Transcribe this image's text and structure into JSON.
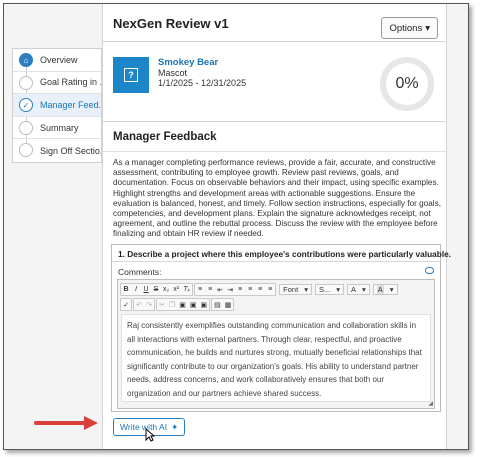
{
  "header": {
    "title": "NexGen Review v1",
    "options_label": "Options"
  },
  "steps": [
    {
      "label": "Overview",
      "state": "home"
    },
    {
      "label": "Goal Rating in ...",
      "state": "pending"
    },
    {
      "label": "Manager Feed...",
      "state": "active"
    },
    {
      "label": "Summary",
      "state": "pending"
    },
    {
      "label": "Sign Off Sectio...",
      "state": "pending"
    }
  ],
  "employee": {
    "name": "Smokey Bear",
    "role": "Mascot",
    "dates": "1/1/2025 - 12/31/2025",
    "progress_text": "0%",
    "progress": 0
  },
  "section": {
    "title": "Manager Feedback",
    "instructions": "As a manager completing performance reviews, provide a fair, accurate, and constructive assessment, contributing to employee growth. Review past reviews, goals, and documentation. Focus on observable behaviors and their impact, using specific examples. Highlight strengths and development areas with actionable suggestions. Ensure the evaluation is balanced, honest, and timely. Follow section instructions, especially for goals, competencies, and development plans. Explain the signature acknowledges receipt, not agreement, and outline the rebuttal process. Discuss the review with the employee before finalizing and obtain HR review if needed."
  },
  "question": {
    "title": "1. Describe a project where this employee's contributions were particularly valuable.",
    "comments_label": "Comments:",
    "toolbar": {
      "font_label": "Font",
      "size_label": "S...",
      "color_label": "A",
      "highlight_label": "A"
    },
    "body_text": "Raj consistently exemplifies outstanding communication and collaboration skills in all interactions with external partners. Through clear, respectful, and proactive communication, he builds and nurtures strong, mutually beneficial relationships that significantly contribute to our organization's goals. His ability to understand partner needs, address concerns, and work collaboratively ensures that both our organization and our partners achieve shared success."
  },
  "ai_button": {
    "label": "Write with AI"
  },
  "colors": {
    "accent": "#1a73b5",
    "annotation_arrow": "#d9403a"
  }
}
